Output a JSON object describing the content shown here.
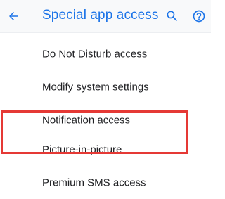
{
  "header": {
    "title": "Special app access",
    "back_icon": "arrow-back-icon",
    "search_icon": "search-icon",
    "help_icon": "help-icon",
    "accent_color": "#1a73e8"
  },
  "settings": {
    "items": [
      {
        "label": "Do Not Disturb access"
      },
      {
        "label": "Modify system settings"
      },
      {
        "label": "Notification access"
      },
      {
        "label": "Picture-in-picture",
        "highlighted": true
      },
      {
        "label": "Premium SMS access"
      }
    ]
  },
  "annotation": {
    "highlight_color": "#e53935"
  }
}
